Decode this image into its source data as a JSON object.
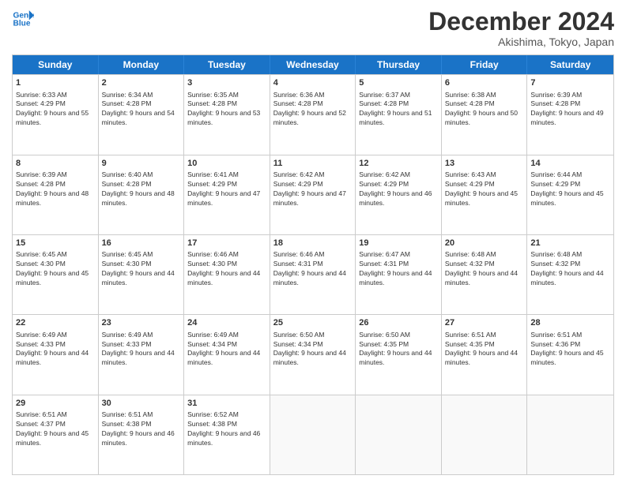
{
  "header": {
    "logo_line1": "General",
    "logo_line2": "Blue",
    "month_title": "December 2024",
    "location": "Akishima, Tokyo, Japan"
  },
  "days_of_week": [
    "Sunday",
    "Monday",
    "Tuesday",
    "Wednesday",
    "Thursday",
    "Friday",
    "Saturday"
  ],
  "weeks": [
    [
      {
        "day": 1,
        "sunrise": "6:33 AM",
        "sunset": "4:29 PM",
        "daylight": "9 hours and 55 minutes."
      },
      {
        "day": 2,
        "sunrise": "6:34 AM",
        "sunset": "4:28 PM",
        "daylight": "9 hours and 54 minutes."
      },
      {
        "day": 3,
        "sunrise": "6:35 AM",
        "sunset": "4:28 PM",
        "daylight": "9 hours and 53 minutes."
      },
      {
        "day": 4,
        "sunrise": "6:36 AM",
        "sunset": "4:28 PM",
        "daylight": "9 hours and 52 minutes."
      },
      {
        "day": 5,
        "sunrise": "6:37 AM",
        "sunset": "4:28 PM",
        "daylight": "9 hours and 51 minutes."
      },
      {
        "day": 6,
        "sunrise": "6:38 AM",
        "sunset": "4:28 PM",
        "daylight": "9 hours and 50 minutes."
      },
      {
        "day": 7,
        "sunrise": "6:39 AM",
        "sunset": "4:28 PM",
        "daylight": "9 hours and 49 minutes."
      }
    ],
    [
      {
        "day": 8,
        "sunrise": "6:39 AM",
        "sunset": "4:28 PM",
        "daylight": "9 hours and 48 minutes."
      },
      {
        "day": 9,
        "sunrise": "6:40 AM",
        "sunset": "4:28 PM",
        "daylight": "9 hours and 48 minutes."
      },
      {
        "day": 10,
        "sunrise": "6:41 AM",
        "sunset": "4:29 PM",
        "daylight": "9 hours and 47 minutes."
      },
      {
        "day": 11,
        "sunrise": "6:42 AM",
        "sunset": "4:29 PM",
        "daylight": "9 hours and 47 minutes."
      },
      {
        "day": 12,
        "sunrise": "6:42 AM",
        "sunset": "4:29 PM",
        "daylight": "9 hours and 46 minutes."
      },
      {
        "day": 13,
        "sunrise": "6:43 AM",
        "sunset": "4:29 PM",
        "daylight": "9 hours and 45 minutes."
      },
      {
        "day": 14,
        "sunrise": "6:44 AM",
        "sunset": "4:29 PM",
        "daylight": "9 hours and 45 minutes."
      }
    ],
    [
      {
        "day": 15,
        "sunrise": "6:45 AM",
        "sunset": "4:30 PM",
        "daylight": "9 hours and 45 minutes."
      },
      {
        "day": 16,
        "sunrise": "6:45 AM",
        "sunset": "4:30 PM",
        "daylight": "9 hours and 44 minutes."
      },
      {
        "day": 17,
        "sunrise": "6:46 AM",
        "sunset": "4:30 PM",
        "daylight": "9 hours and 44 minutes."
      },
      {
        "day": 18,
        "sunrise": "6:46 AM",
        "sunset": "4:31 PM",
        "daylight": "9 hours and 44 minutes."
      },
      {
        "day": 19,
        "sunrise": "6:47 AM",
        "sunset": "4:31 PM",
        "daylight": "9 hours and 44 minutes."
      },
      {
        "day": 20,
        "sunrise": "6:48 AM",
        "sunset": "4:32 PM",
        "daylight": "9 hours and 44 minutes."
      },
      {
        "day": 21,
        "sunrise": "6:48 AM",
        "sunset": "4:32 PM",
        "daylight": "9 hours and 44 minutes."
      }
    ],
    [
      {
        "day": 22,
        "sunrise": "6:49 AM",
        "sunset": "4:33 PM",
        "daylight": "9 hours and 44 minutes."
      },
      {
        "day": 23,
        "sunrise": "6:49 AM",
        "sunset": "4:33 PM",
        "daylight": "9 hours and 44 minutes."
      },
      {
        "day": 24,
        "sunrise": "6:49 AM",
        "sunset": "4:34 PM",
        "daylight": "9 hours and 44 minutes."
      },
      {
        "day": 25,
        "sunrise": "6:50 AM",
        "sunset": "4:34 PM",
        "daylight": "9 hours and 44 minutes."
      },
      {
        "day": 26,
        "sunrise": "6:50 AM",
        "sunset": "4:35 PM",
        "daylight": "9 hours and 44 minutes."
      },
      {
        "day": 27,
        "sunrise": "6:51 AM",
        "sunset": "4:35 PM",
        "daylight": "9 hours and 44 minutes."
      },
      {
        "day": 28,
        "sunrise": "6:51 AM",
        "sunset": "4:36 PM",
        "daylight": "9 hours and 45 minutes."
      }
    ],
    [
      {
        "day": 29,
        "sunrise": "6:51 AM",
        "sunset": "4:37 PM",
        "daylight": "9 hours and 45 minutes."
      },
      {
        "day": 30,
        "sunrise": "6:51 AM",
        "sunset": "4:38 PM",
        "daylight": "9 hours and 46 minutes."
      },
      {
        "day": 31,
        "sunrise": "6:52 AM",
        "sunset": "4:38 PM",
        "daylight": "9 hours and 46 minutes."
      },
      null,
      null,
      null,
      null
    ]
  ]
}
